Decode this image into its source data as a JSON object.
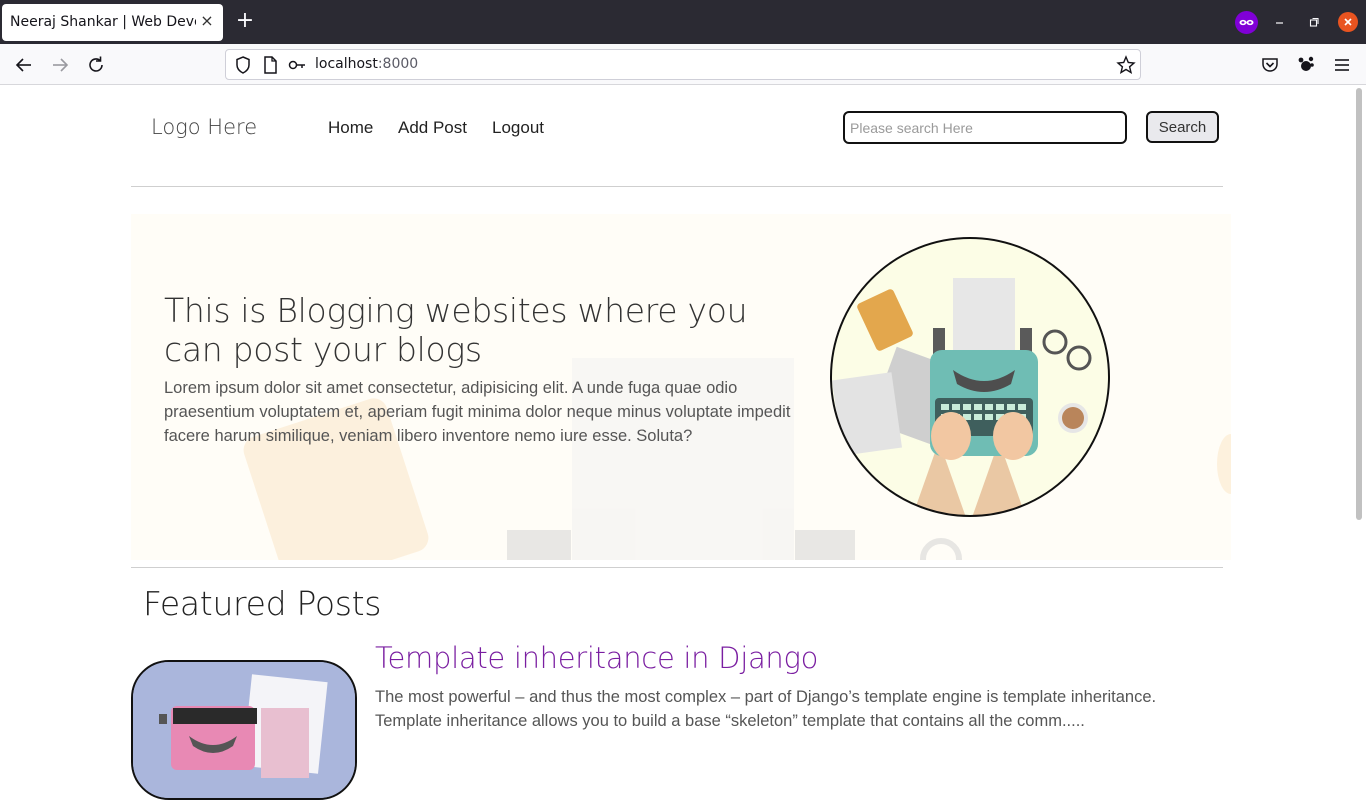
{
  "browser": {
    "tab_title": "Neeraj Shankar | Web Developer",
    "tab_close": "×",
    "new_tab": "+",
    "url_host": "localhost",
    "url_port": ":8000"
  },
  "header": {
    "logo": "Logo Here",
    "nav": [
      "Home",
      "Add Post",
      "Logout"
    ],
    "search_placeholder": "Please search Here",
    "search_button": "Search"
  },
  "hero": {
    "title": "This is Blogging websites where you can post your blogs",
    "text": "Lorem ipsum dolor sit amet consectetur, adipisicing elit. A unde fuga quae odio praesentium voluptatem et, aperiam fugit minima dolor neque minus voluptate impedit facere harum similique, veniam libero inventore nemo iure esse. Soluta?"
  },
  "featured": {
    "heading": "Featured Posts",
    "posts": [
      {
        "title": "Template inheritance in Django",
        "excerpt": "The most powerful – and thus the most complex – part of Django’s template engine is template inheritance. Template inheritance allows you to build a base “skeleton” template that contains all the comm....."
      }
    ]
  },
  "colors": {
    "accent_link": "#7a1ea1",
    "hero_bg": "#fffdf7",
    "browser_dark": "#2b2a33",
    "private_purple": "#8000d7"
  }
}
